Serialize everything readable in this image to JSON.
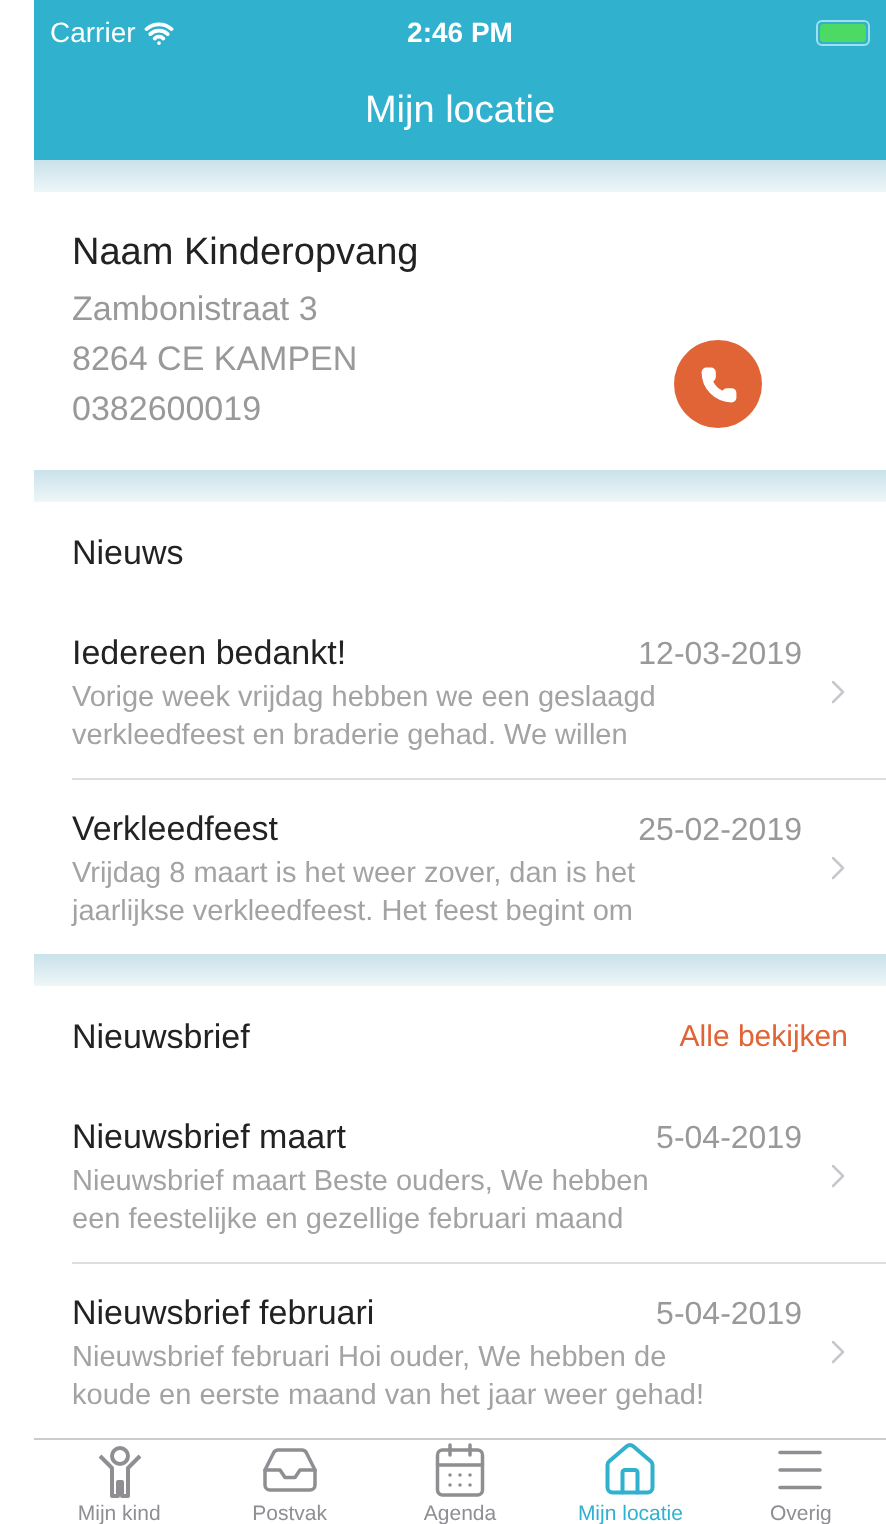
{
  "status_bar": {
    "carrier": "Carrier",
    "time": "2:46 PM"
  },
  "nav": {
    "title": "Mijn locatie"
  },
  "location": {
    "name": "Naam Kinderopvang",
    "lines": [
      "Zambonistraat 3",
      "8264 CE KAMPEN",
      "0382600019"
    ]
  },
  "sections": [
    {
      "title": "Nieuws",
      "items": [
        {
          "title": "Iedereen bedankt!",
          "date": "12-03-2019",
          "lines": [
            "Vorige week vrijdag hebben we een geslaagd",
            "verkleedfeest en braderie gehad. We willen"
          ]
        },
        {
          "title": "Verkleedfeest",
          "date": "25-02-2019",
          "lines": [
            "Vrijdag 8 maart is het weer zover, dan is het",
            "jaarlijkse verkleedfeest. Het feest begint om"
          ]
        }
      ]
    },
    {
      "title": "Nieuwsbrief",
      "link": "Alle bekijken",
      "items": [
        {
          "title": "Nieuwsbrief maart",
          "date": "5-04-2019",
          "lines": [
            "Nieuwsbrief maart Beste ouders,  We hebben",
            "een feestelijke en gezellige februari maand"
          ]
        },
        {
          "title": "Nieuwsbrief februari",
          "date": "5-04-2019",
          "lines": [
            "Nieuwsbrief februari Hoi ouder,  We hebben de",
            "koude en eerste maand van het jaar weer gehad!"
          ]
        }
      ]
    }
  ],
  "tabs": [
    {
      "kind": "child",
      "label": "Mijn kind",
      "selected": false
    },
    {
      "kind": "inbox",
      "label": "Postvak",
      "selected": false
    },
    {
      "kind": "calendar",
      "label": "Agenda",
      "selected": false
    },
    {
      "kind": "home",
      "label": "Mijn locatie",
      "selected": true
    },
    {
      "kind": "menu",
      "label": "Overig",
      "selected": false
    }
  ]
}
